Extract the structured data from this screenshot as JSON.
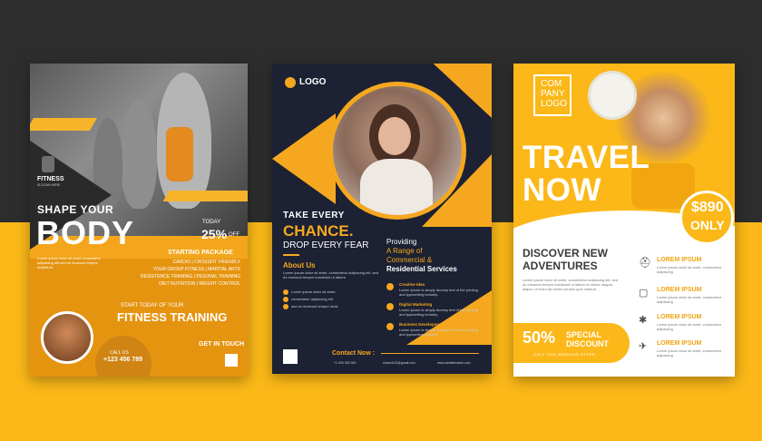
{
  "flyer1": {
    "logo_name": "FITNESS",
    "logo_slogan": "SLOGAN HERE",
    "headline_small": "SHAPE YOUR",
    "headline_big": "BODY",
    "today_label": "TODAY",
    "discount": "25%",
    "off_label": "OFF",
    "package_title": "STARTING PACKAGE",
    "package_lines": [
      "CARDIO | CROSSFIT FRIENDLY",
      "YOUR GROUP FITNESS | MARTIAL ARTS",
      "RESISTENCE TRAINING | PESONAL TRAINING",
      "DIET NUTRITION | WEIGHT CONTROL"
    ],
    "start_today": "START TODAY OF YOUR",
    "program": "FITNESS TRAINING",
    "call_us": "CALL US",
    "phone": "+123 456 789",
    "get_in_touch": "GET IN TOUCH"
  },
  "flyer2": {
    "logo": "LOGO",
    "take": "TAKE EVERY",
    "chance": "CHANCE.",
    "drop": "DROP EVERY FEAR",
    "providing": "Providing",
    "range": "A Range of",
    "commercial": "Commercial &",
    "residential": "Residential Services",
    "about_title": "About Us",
    "services": [
      "Creative Idea",
      "Digital Marketing",
      "Business Development"
    ],
    "contact_title": "Contact Now :",
    "contact_items": [
      "+1 000 000 000",
      "sharmi123@gmail.com",
      "www.websitename.com"
    ]
  },
  "flyer3": {
    "company": [
      "COM",
      "PANY",
      "LOGO"
    ],
    "headline": [
      "TRAVEL",
      "NOW"
    ],
    "price": "$890",
    "price_suffix": "ONLY",
    "discover": [
      "DISCOVER NEW",
      "ADVENTURES"
    ],
    "items": [
      "LOREM IPSUM",
      "LOREM IPSUM",
      "LOREM IPSUM",
      "LOREM IPSUM"
    ],
    "discount": "50%",
    "special": [
      "SPECIAL",
      "DISCOUNT"
    ],
    "offer_note": "ONLY THIS WEEKEND OFFER"
  },
  "colors": {
    "accent_yellow": "#fbb818",
    "dark_navy": "#1c2133",
    "fitness_orange": "#f3a61b",
    "bg_dark": "#2d2d2d"
  },
  "icons": [
    "cap-icon",
    "bag-icon",
    "palm-icon",
    "plane-icon",
    "check-icon",
    "qr-code-icon"
  ]
}
